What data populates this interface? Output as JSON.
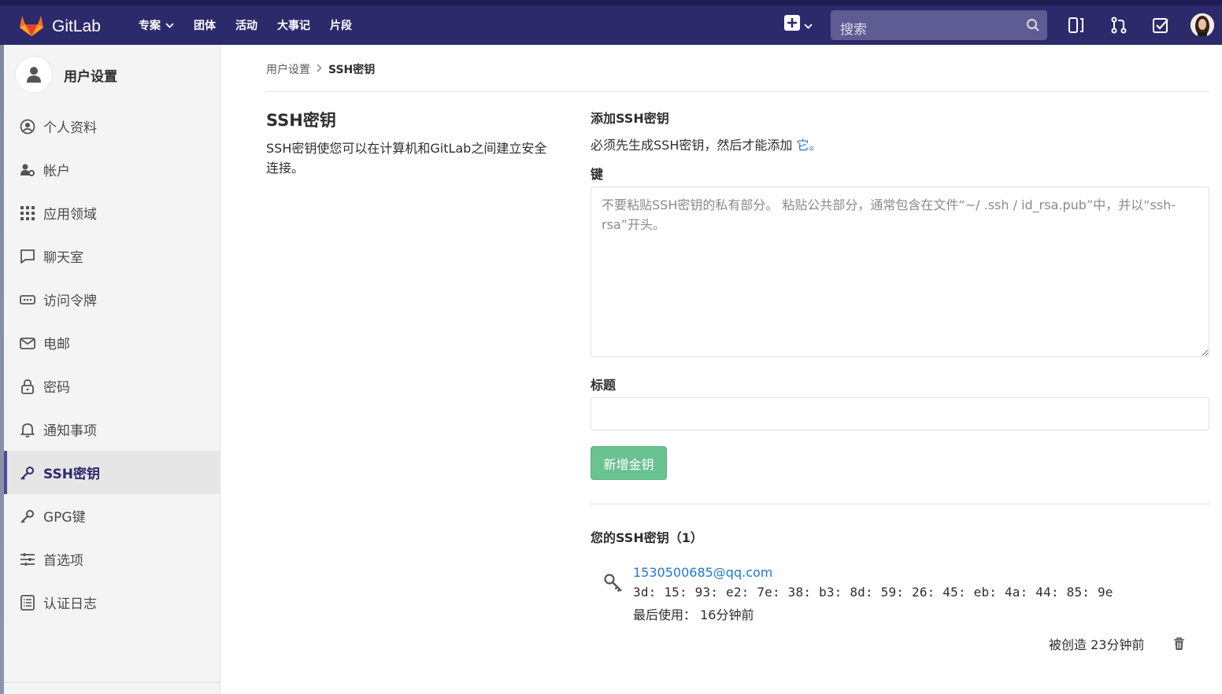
{
  "topbar": {
    "brand": "GitLab",
    "nav": [
      "专案",
      "团体",
      "活动",
      "大事记",
      "片段"
    ],
    "search_placeholder": "搜索",
    "icons": [
      "plus-square-icon",
      "sidebar-toggle-icon",
      "merge-request-icon",
      "todo-icon"
    ],
    "colors": {
      "bar": "#2d2a6b",
      "search": "#5f5c93"
    }
  },
  "sidebar": {
    "title": "用户设置",
    "items": [
      {
        "label": "个人资料",
        "icon": "profile-icon"
      },
      {
        "label": "帐户",
        "icon": "account-icon"
      },
      {
        "label": "应用领域",
        "icon": "applications-icon"
      },
      {
        "label": "聊天室",
        "icon": "chat-icon"
      },
      {
        "label": "访问令牌",
        "icon": "token-icon"
      },
      {
        "label": "电邮",
        "icon": "mail-icon"
      },
      {
        "label": "密码",
        "icon": "lock-icon"
      },
      {
        "label": "通知事项",
        "icon": "bell-icon"
      },
      {
        "label": "SSH密钥",
        "icon": "key-icon",
        "active": true
      },
      {
        "label": "GPG键",
        "icon": "key-icon"
      },
      {
        "label": "首选项",
        "icon": "preferences-icon"
      },
      {
        "label": "认证日志",
        "icon": "log-icon"
      }
    ]
  },
  "breadcrumb": {
    "parent": "用户设置",
    "current": "SSH密钥"
  },
  "intro": {
    "title": "SSH密钥",
    "description": "SSH密钥使您可以在计算机和GitLab之间建立安全连接。"
  },
  "form": {
    "title": "添加SSH密钥",
    "desc_prefix": "必须先生成SSH密钥，然后才能添加",
    "desc_link": "它。",
    "key_label": "键",
    "key_placeholder": "不要粘贴SSH密钥的私有部分。 粘贴公共部分，通常包含在文件“~/ .ssh / id_rsa.pub”中，并以“ssh-rsa”开头。",
    "title_label": "标题",
    "title_value": "",
    "submit_label": "新增金钥",
    "submit_color": "#69c28f"
  },
  "keys": {
    "heading": "您的SSH密钥（1）",
    "list": [
      {
        "name": "1530500685@qq.com",
        "fingerprint": "3d: 15: 93: e2: 7e: 38: b3: 8d: 59: 26: 45: eb: 4a: 44: 85: 9e",
        "last_used": "最后使用： 16分钟前",
        "created": "被创造 23分钟前"
      }
    ]
  }
}
